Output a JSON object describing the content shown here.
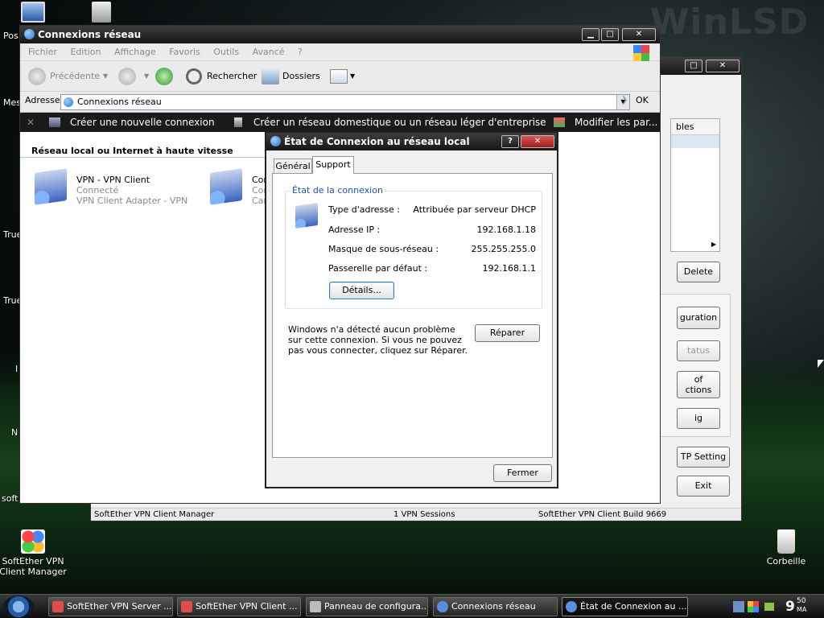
{
  "desktop": {
    "watermark": "WinLSD",
    "icons": [
      {
        "label": "Pos"
      },
      {
        "label": "Mes"
      },
      {
        "label": "True"
      },
      {
        "label": "True"
      },
      {
        "label": "I"
      },
      {
        "label": "N"
      },
      {
        "label": "soft"
      }
    ],
    "softether_icon": "SoftEther VPN Client Manager",
    "recycle_icon": "Corbeille"
  },
  "bg_window": {
    "header": "bles",
    "buttons": [
      "Delete",
      "guration",
      "tatus",
      "of\nctions",
      "ig",
      "TP Setting",
      "Exit"
    ],
    "status": [
      "SoftEther VPN Client Manager",
      "1 VPN Sessions",
      "SoftEther VPN Client Build 9669"
    ]
  },
  "explorer": {
    "title": "Connexions réseau",
    "menu": [
      "Fichier",
      "Edition",
      "Affichage",
      "Favoris",
      "Outils",
      "Avancé",
      "?"
    ],
    "toolbar": {
      "back": "Précédente",
      "search": "Rechercher",
      "folders": "Dossiers"
    },
    "address": {
      "label": "Adresse",
      "value": "Connexions réseau",
      "go": "OK"
    },
    "tasks": [
      "Créer une nouvelle connexion",
      "Créer un réseau domestique ou un réseau léger d'entreprise",
      "Modifier les par..."
    ],
    "section": "Réseau local ou Internet à haute vitesse",
    "connections": [
      {
        "name": "VPN - VPN Client",
        "status": "Connecté",
        "device": "VPN Client Adapter - VPN"
      },
      {
        "name": "Con",
        "status": "Con",
        "device": "Car"
      }
    ]
  },
  "dialog": {
    "title": "État de Connexion au réseau local",
    "tabs": [
      "Général",
      "Support"
    ],
    "active_tab": "Support",
    "group_title": "État de la connexion",
    "rows": [
      {
        "label": "Type d'adresse :",
        "value": "Attribuée par serveur DHCP"
      },
      {
        "label": "Adresse IP :",
        "value": "192.168.1.18"
      },
      {
        "label": "Masque de sous-réseau :",
        "value": "255.255.255.0"
      },
      {
        "label": "Passerelle par défaut :",
        "value": "192.168.1.1"
      }
    ],
    "details_button": "Détails...",
    "message": "Windows n'a détecté aucun problème sur cette connexion. Si vous ne pouvez pas vous connecter, cliquez sur Réparer.",
    "repair_button": "Réparer",
    "close_button": "Fermer"
  },
  "taskbar": {
    "buttons": [
      "SoftEther VPN Server ...",
      "SoftEther VPN Client ...",
      "Panneau de configura...",
      "Connexions réseau",
      "État de Connexion au ..."
    ],
    "active_index": 4,
    "clock": {
      "hour": "9",
      "minutes": "50",
      "suffix": "MA"
    }
  },
  "colors": {
    "accent": "#2b6fc4",
    "titlebar": "#1e1e1e",
    "group_title": "#2255aa"
  }
}
